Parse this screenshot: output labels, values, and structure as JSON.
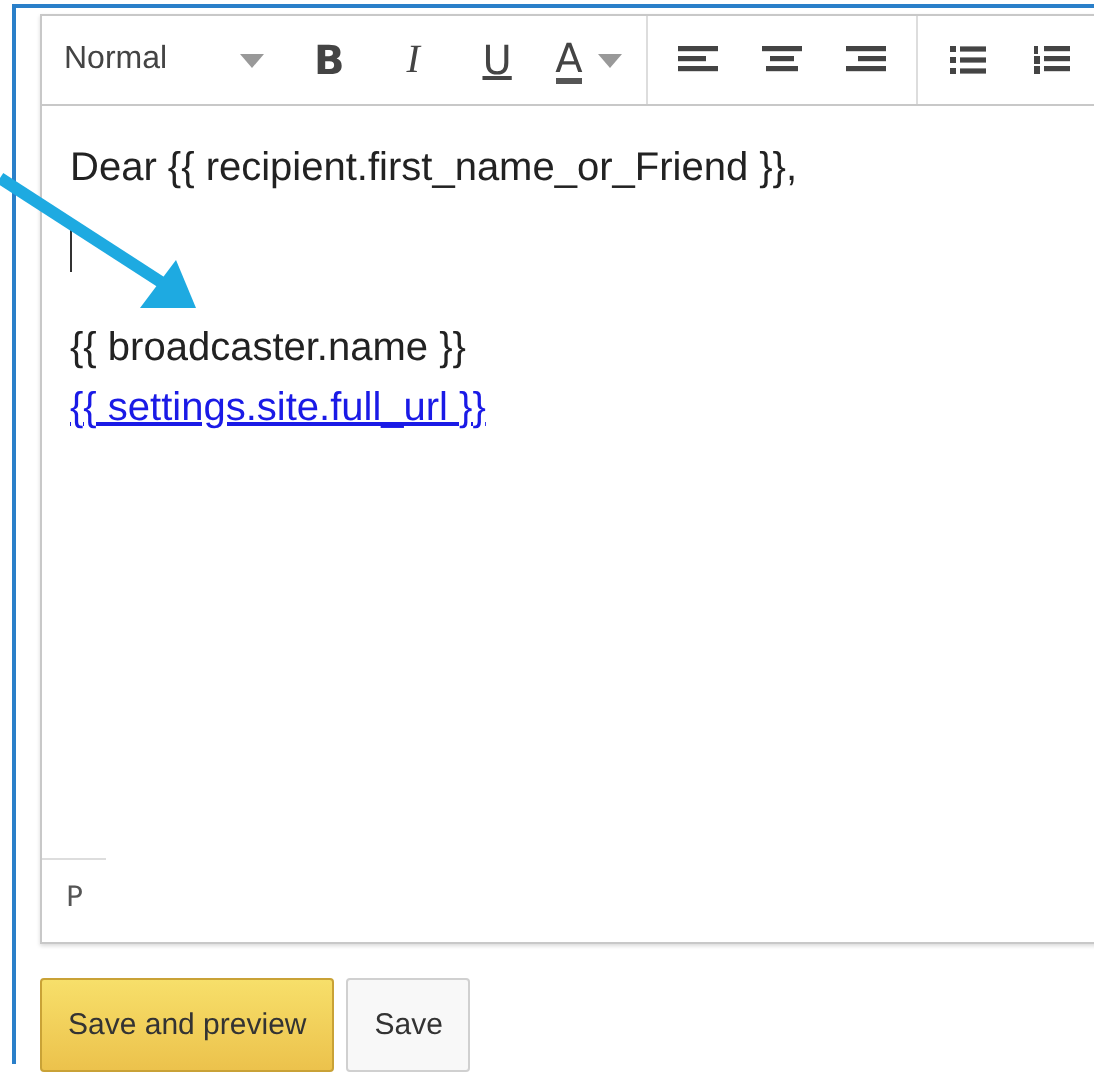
{
  "toolbar": {
    "format": "Normal",
    "groups": [
      {
        "items": [
          {
            "kind": "bold",
            "label": "B"
          },
          {
            "kind": "italic",
            "label": "I"
          },
          {
            "kind": "underline",
            "label": "U"
          },
          {
            "kind": "color",
            "label": "A"
          }
        ]
      },
      {
        "items": [
          {
            "kind": "align-left"
          },
          {
            "kind": "align-center"
          },
          {
            "kind": "align-right"
          }
        ]
      },
      {
        "items": [
          {
            "kind": "bullet-list"
          },
          {
            "kind": "numbered-list"
          }
        ]
      }
    ]
  },
  "content": [
    {
      "kind": "text",
      "text": "Dear {{ recipient.first_name_or_Friend }},"
    },
    {
      "kind": "caret"
    },
    {
      "kind": "text",
      "text": "{{ broadcaster.name }}"
    },
    {
      "kind": "link",
      "text": "{{ settings.site.full_url }}"
    }
  ],
  "status_bar": {
    "path": "P"
  },
  "buttons": [
    {
      "kind": "primary",
      "label": "Save and preview"
    },
    {
      "kind": "default",
      "label": "Save"
    }
  ]
}
